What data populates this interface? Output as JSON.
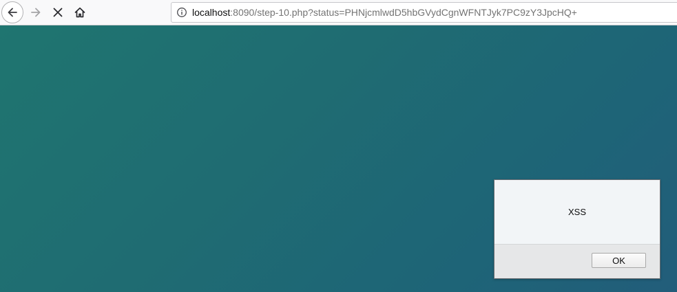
{
  "browser": {
    "toolbar": {
      "back_icon": "arrow-left-icon",
      "forward_icon": "arrow-right-icon",
      "stop_icon": "close-icon",
      "home_icon": "home-icon"
    },
    "url_bar": {
      "icon": "info-icon",
      "host": "localhost",
      "rest": ":8090/step-10.php?status=PHNjcmlwdD5hbGVydCgnWFNTJyk7PC9zY3JpcHQ+"
    }
  },
  "page": {
    "background_colors": [
      "#1f7570",
      "#225d7a"
    ]
  },
  "alert_dialog": {
    "message": "XSS",
    "ok_label": "OK"
  }
}
